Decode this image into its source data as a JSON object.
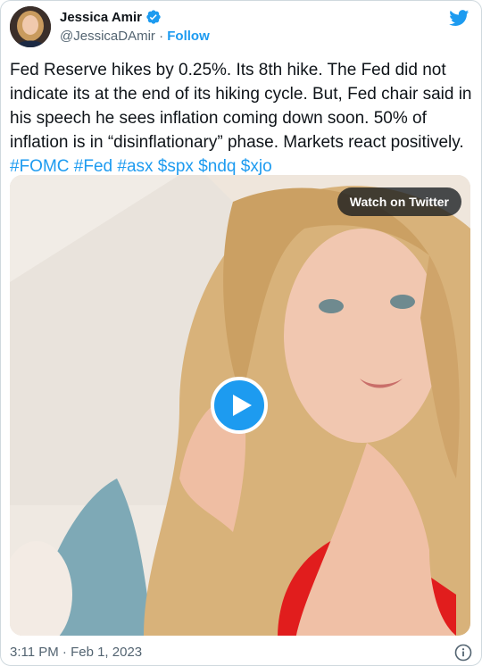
{
  "author": {
    "name": "Jessica Amir",
    "handle": "@JessicaDAmir",
    "separator": "·",
    "follow_label": "Follow"
  },
  "tweet": {
    "text": "Fed Reserve hikes by 0.25%. Its 8th hike. The Fed did not indicate its at the end of its hiking cycle. But, Fed chair said in his speech he sees inflation coming down soon. 50% of inflation is in “disinflationary” phase. Markets react positively.",
    "hashtags": [
      "#FOMC",
      "#Fed",
      "#asx"
    ],
    "cashtags": [
      "$spx",
      "$ndq",
      "$xjo"
    ]
  },
  "media": {
    "watch_label": "Watch on Twitter"
  },
  "footer": {
    "timestamp": "3:11 PM · Feb 1, 2023"
  },
  "colors": {
    "accent": "#1d9bf0",
    "text": "#0f1419",
    "secondary": "#536471",
    "border": "#cfd9de"
  },
  "icons": [
    "verified-badge-icon",
    "twitter-bird-icon",
    "play-icon",
    "info-icon"
  ]
}
